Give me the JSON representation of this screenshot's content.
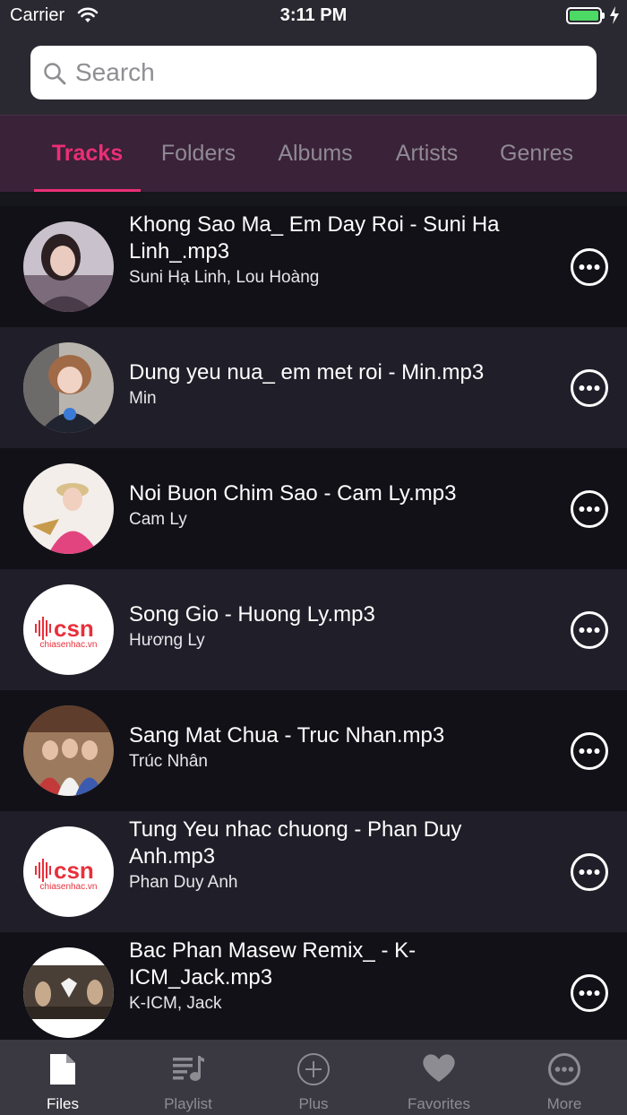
{
  "status_bar": {
    "carrier": "Carrier",
    "time": "3:11 PM",
    "battery_color": "#4cd964"
  },
  "search": {
    "placeholder": "Search",
    "value": ""
  },
  "tabs": [
    {
      "label": "Tracks",
      "active": true
    },
    {
      "label": "Folders",
      "active": false
    },
    {
      "label": "Albums",
      "active": false
    },
    {
      "label": "Artists",
      "active": false
    },
    {
      "label": "Genres",
      "active": false
    }
  ],
  "accent_color": "#ea2f75",
  "tracks": [
    {
      "title": "Khong Sao Ma_ Em Day Roi - Suni Ha Linh_.mp3",
      "artist": "Suni Hạ Linh, Lou Hoàng",
      "thumbnail": "album-art-photo"
    },
    {
      "title": "Dung yeu nua_ em met roi - Min.mp3",
      "artist": "Min",
      "thumbnail": "album-art-photo"
    },
    {
      "title": "Noi Buon Chim Sao - Cam Ly.mp3",
      "artist": "Cam Ly",
      "thumbnail": "album-art-photo"
    },
    {
      "title": "Song Gio - Huong Ly.mp3",
      "artist": "Hương Ly",
      "thumbnail": "csn-logo",
      "logo_text": "csn",
      "logo_sub": "chiasenhac.vn"
    },
    {
      "title": "Sang Mat Chua - Truc Nhan.mp3",
      "artist": "Trúc Nhân",
      "thumbnail": "album-art-photo"
    },
    {
      "title": "Tung Yeu nhac chuong - Phan Duy Anh.mp3",
      "artist": "Phan Duy Anh",
      "thumbnail": "csn-logo",
      "logo_text": "csn",
      "logo_sub": "chiasenhac.vn"
    },
    {
      "title": "Bac Phan Masew Remix_ - K-ICM_Jack.mp3",
      "artist": "K-ICM, Jack",
      "thumbnail": "album-art-photo"
    }
  ],
  "tab_bar": [
    {
      "label": "Files",
      "icon": "file-icon",
      "active": true
    },
    {
      "label": "Playlist",
      "icon": "playlist-icon",
      "active": false
    },
    {
      "label": "Plus",
      "icon": "plus-circle-icon",
      "active": false
    },
    {
      "label": "Favorites",
      "icon": "heart-icon",
      "active": false
    },
    {
      "label": "More",
      "icon": "more-circle-icon",
      "active": false
    }
  ]
}
